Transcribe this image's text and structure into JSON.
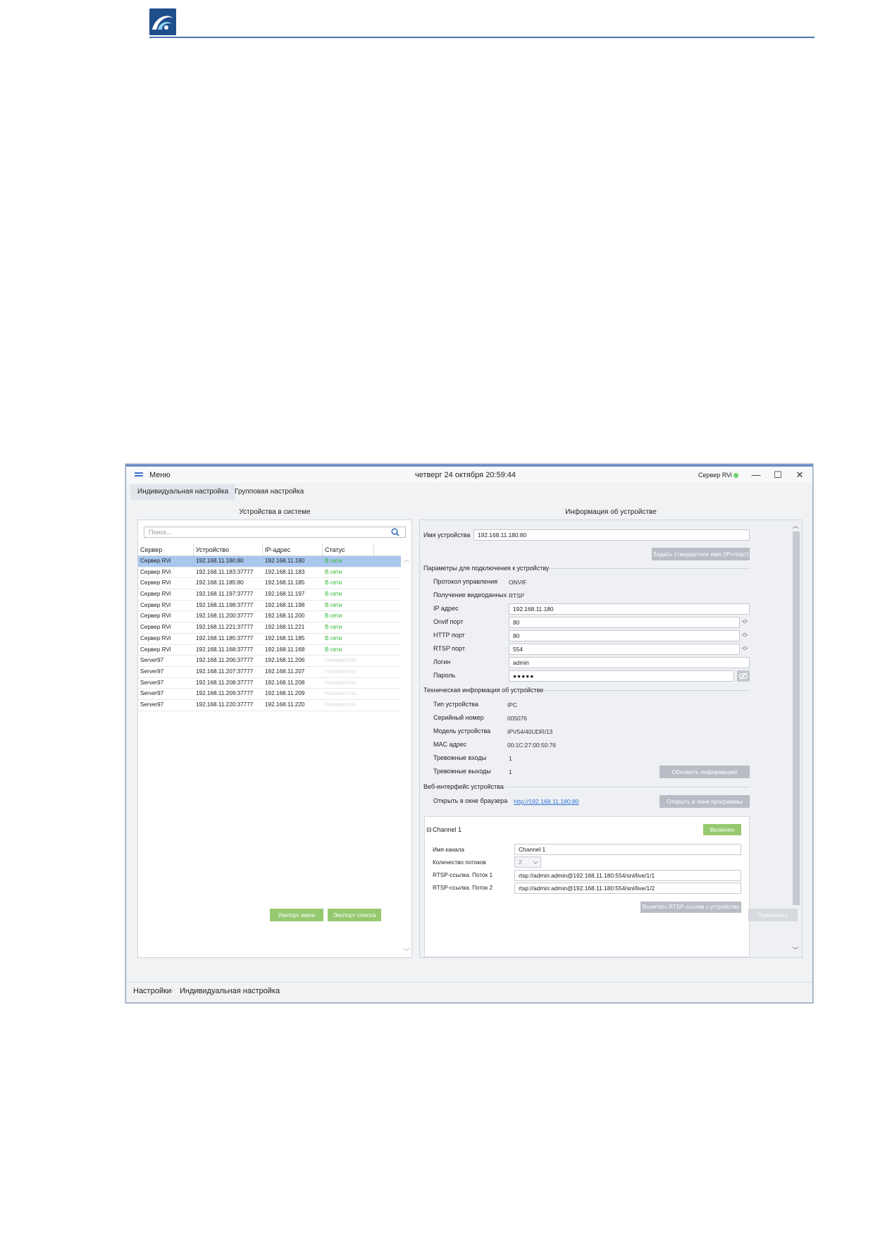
{
  "titlebar": {
    "menu_label": "Меню",
    "datetime": "четверг 24 октября 20:59:44",
    "server": "Сервер RVi",
    "minimize": "—",
    "maximize": "☐",
    "close": "✕"
  },
  "tabs": [
    {
      "label": "Индивидуальная настройка",
      "active": true
    },
    {
      "label": "Групповая настройка",
      "active": false
    }
  ],
  "left": {
    "title": "Устройства в системе",
    "search_placeholder": "Поиск...",
    "columns": [
      "Сервер",
      "Устройство",
      "IP-адрес",
      "Статус"
    ],
    "rows": [
      {
        "server": "Сервер RVi",
        "device": "192.168.11.180:80",
        "ip": "192.168.11.180",
        "status": "В сети",
        "state": "online",
        "selected": true
      },
      {
        "server": "Сервер RVi",
        "device": "192.168.11.183:37777",
        "ip": "192.168.11.183",
        "status": "В сети",
        "state": "online"
      },
      {
        "server": "Сервер RVi",
        "device": "192.168.11.185:80",
        "ip": "192.168.11.185",
        "status": "В сети",
        "state": "online"
      },
      {
        "server": "Сервер RVi",
        "device": "192.168.11.197:37777",
        "ip": "192.168.11.197",
        "status": "В сети",
        "state": "online"
      },
      {
        "server": "Сервер RVi",
        "device": "192.168.11.198:37777",
        "ip": "192.168.11.198",
        "status": "В сети",
        "state": "online"
      },
      {
        "server": "Сервер RVi",
        "device": "192.168.11.200:37777",
        "ip": "192.168.11.200",
        "status": "В сети",
        "state": "online"
      },
      {
        "server": "Сервер RVi",
        "device": "192.168.11.221:37777",
        "ip": "192.168.11.221",
        "status": "В сети",
        "state": "online"
      },
      {
        "server": "Сервер RVi",
        "device": "192.168.11.185:37777",
        "ip": "192.168.11.185",
        "status": "В сети",
        "state": "online"
      },
      {
        "server": "Сервер RVi",
        "device": "192.168.11.168:37777",
        "ip": "192.168.11.168",
        "status": "В сети",
        "state": "online"
      },
      {
        "server": "Server97",
        "device": "192.168.11.206:37777",
        "ip": "192.168.11.206",
        "status": "Неизвестно",
        "state": "unknown"
      },
      {
        "server": "Server97",
        "device": "192.168.11.207:37777",
        "ip": "192.168.11.207",
        "status": "Неизвестно",
        "state": "unknown"
      },
      {
        "server": "Server97",
        "device": "192.168.11.208:37777",
        "ip": "192.168.11.208",
        "status": "Неизвестно",
        "state": "unknown"
      },
      {
        "server": "Server97",
        "device": "192.168.11.209:37777",
        "ip": "192.168.11.209",
        "status": "Неизвестно",
        "state": "unknown"
      },
      {
        "server": "Server97",
        "device": "192.168.11.220:37777",
        "ip": "192.168.11.220",
        "status": "Неизвестно",
        "state": "unknown"
      }
    ],
    "import_button": "Импорт имен",
    "export_button": "Экспорт списка"
  },
  "right": {
    "title": "Информация об устройстве",
    "device_name_label": "Имя устройства",
    "device_name_value": "192.168.11.180:80",
    "default_name_button": "Задать стандартное имя (IP+порт)",
    "connection_section": "Параметры для подключения к устройству",
    "protocol_label": "Протокол управления",
    "protocol_value": "ONVIF",
    "video_label": "Получение видеоданных",
    "video_value": "RTSP",
    "ip_label": "IP адрес",
    "ip_value": "192.168.11.180",
    "onvif_label": "Onvif порт",
    "onvif_value": "80",
    "http_label": "HTTP порт",
    "http_value": "80",
    "rtsp_label": "RTSP порт",
    "rtsp_value": "554",
    "login_label": "Логин",
    "login_value": "admin",
    "password_label": "Пароль",
    "password_value": "●●●●●",
    "tech_section": "Техническая информация об устройстве",
    "type_label": "Тип устройства",
    "type_value": "IPC",
    "serial_label": "Серийный номер",
    "serial_value": "005076",
    "model_label": "Модель устройства",
    "model_value": "IPV54/40UDR/13",
    "mac_label": "MAC адрес",
    "mac_value": "00:1C:27:00:50:76",
    "alarm_in_label": "Тревожные входы",
    "alarm_in_value": "1",
    "alarm_out_label": "Тревожные выходы",
    "alarm_out_value": "1",
    "refresh_button": "Обновить информацию",
    "web_section": "Веб-интерфейс устройства",
    "browser_label": "Открыть в окне браузера",
    "browser_link": "http://192.168.11.180:80",
    "open_in_app_button": "Открыть в окне программы",
    "channel": {
      "toggle": "⊟",
      "title": "Channel 1",
      "enabled_button": "Включен",
      "name_label": "Имя канала",
      "name_value": "Channel 1",
      "streams_label": "Количество потоков",
      "streams_value": "2",
      "rtsp1_label": "RTSP-ссылка. Поток 1",
      "rtsp1_value": "rtsp://admin:admin@192.168.11.180:554/snl/live/1/1",
      "rtsp2_label": "RTSP-ссылка. Поток 2",
      "rtsp2_value": "rtsp://admin:admin@192.168.11.180:554/snl/live/1/2",
      "read_rtsp_button": "Вычитать RTSP-ссылки с устройства"
    },
    "apply_button": "Применить"
  },
  "breadcrumb": {
    "root": "Настройки",
    "separator": "›",
    "current": "Индивидуальная настройка"
  },
  "colors": {
    "accent_blue": "#3b73c5",
    "online_green": "#2db52d",
    "button_green": "#96c96f",
    "selected_row": "#a9c7ee"
  }
}
